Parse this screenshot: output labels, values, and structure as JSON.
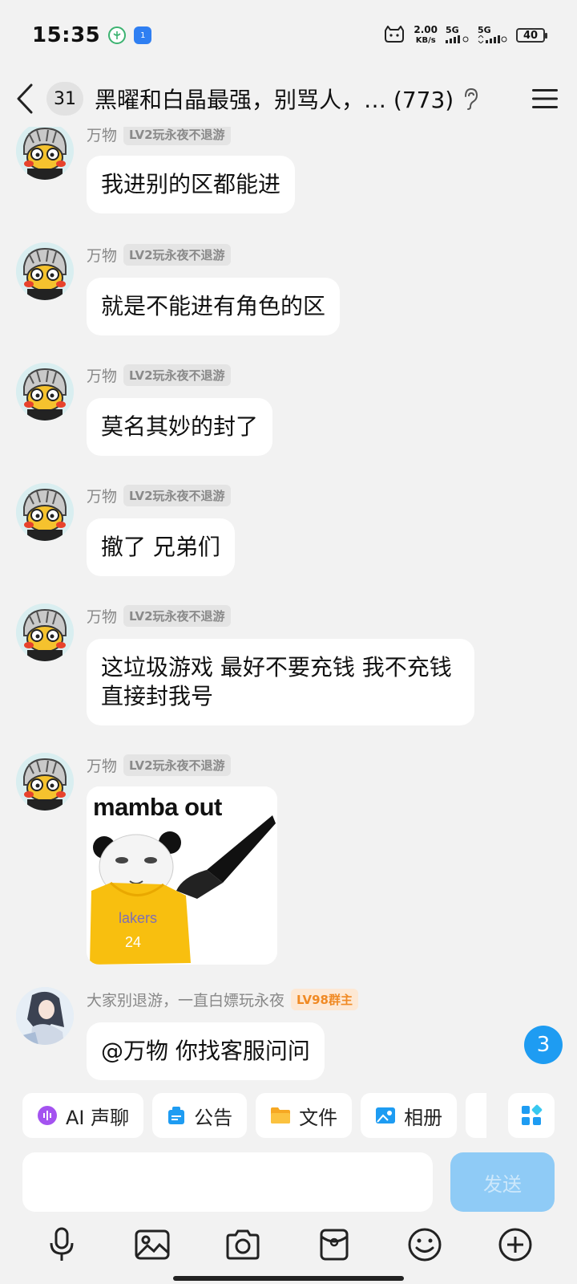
{
  "status_bar": {
    "time": "15:35",
    "app_icon_1": "1",
    "network_speed_value": "2.00",
    "network_speed_unit": "KB/s",
    "sim1": "5G",
    "sim2": "5G",
    "battery": "40"
  },
  "header": {
    "unread_count": "31",
    "title": "黑曜和白晶最强，别骂人，… (773)"
  },
  "messages": [
    {
      "sender": "万物",
      "level": "LV2玩永夜不退游",
      "text": "我进别的区都能进"
    },
    {
      "sender": "万物",
      "level": "LV2玩永夜不退游",
      "text": "就是不能进有角色的区"
    },
    {
      "sender": "万物",
      "level": "LV2玩永夜不退游",
      "text": "莫名其妙的封了"
    },
    {
      "sender": "万物",
      "level": "LV2玩永夜不退游",
      "text": "撤了 兄弟们"
    },
    {
      "sender": "万物",
      "level": "LV2玩永夜不退游",
      "text": "这垃圾游戏 最好不要充钱 我不充钱直接封我号"
    },
    {
      "sender": "万物",
      "level": "LV2玩永夜不退游",
      "image": {
        "caption": "mamba out",
        "jersey_text": "lakers",
        "jersey_number": "24"
      }
    },
    {
      "sender": "大家别退游，一直白嫖玩永夜",
      "level": "LV98群主",
      "text": "@万物 你找客服问问"
    }
  ],
  "floating_unread": "3",
  "quick_actions": [
    {
      "label": "AI 声聊",
      "icon": "ai-voice-icon"
    },
    {
      "label": "公告",
      "icon": "announcement-icon"
    },
    {
      "label": "文件",
      "icon": "folder-icon"
    },
    {
      "label": "相册",
      "icon": "album-icon"
    }
  ],
  "input": {
    "placeholder": "",
    "send_label": "发送"
  },
  "toolbar": [
    "microphone-icon",
    "image-icon",
    "camera-icon",
    "red-packet-icon",
    "emoji-icon",
    "plus-icon"
  ],
  "colors": {
    "accent": "#1e9cf2",
    "send_disabled": "#8fcbf6",
    "owner_tag": "#f08a24",
    "background": "#f2f2f2"
  }
}
